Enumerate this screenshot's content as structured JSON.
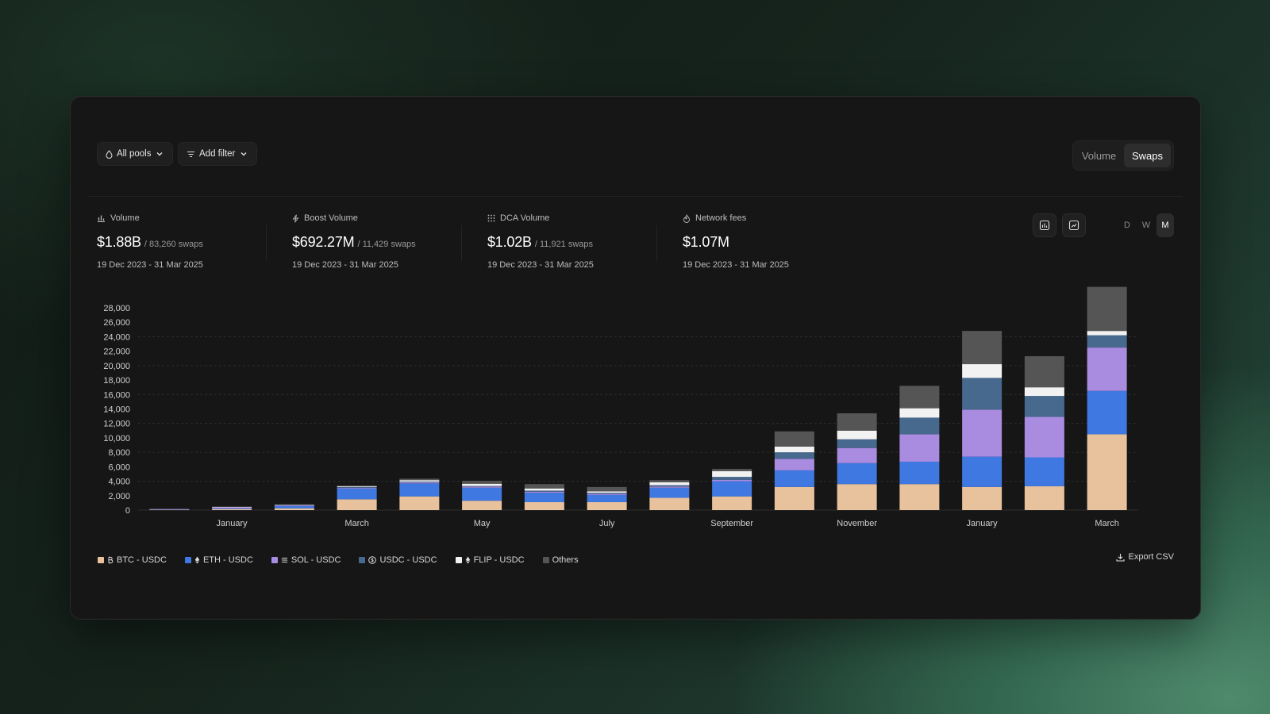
{
  "toolbar": {
    "pools_label": "All pools",
    "filter_label": "Add filter",
    "mode_volume": "Volume",
    "mode_swaps": "Swaps"
  },
  "stats": [
    {
      "label": "Volume",
      "value": "$1.88B",
      "sub": "/ 83,260 swaps",
      "dates": "19 Dec 2023 - 31 Mar 2025",
      "icon": "bar-chart-icon"
    },
    {
      "label": "Boost Volume",
      "value": "$692.27M",
      "sub": "/ 11,429 swaps",
      "dates": "19 Dec 2023 - 31 Mar 2025",
      "icon": "lightning-icon"
    },
    {
      "label": "DCA Volume",
      "value": "$1.02B",
      "sub": "/ 11,921 swaps",
      "dates": "19 Dec 2023 - 31 Mar 2025",
      "icon": "dots-grid-icon"
    },
    {
      "label": "Network fees",
      "value": "$1.07M",
      "sub": "",
      "dates": "19 Dec 2023 - 31 Mar 2025",
      "icon": "flame-icon"
    }
  ],
  "granularity": {
    "d": "D",
    "w": "W",
    "m": "M"
  },
  "legend": [
    {
      "label": "BTC - USDC",
      "color": "#e8c29c",
      "icon": "bitcoin-icon"
    },
    {
      "label": "ETH - USDC",
      "color": "#3f78e0",
      "icon": "ethereum-icon"
    },
    {
      "label": "SOL - USDC",
      "color": "#a98be0",
      "icon": "solana-icon"
    },
    {
      "label": "USDC - USDC",
      "color": "#47698e",
      "icon": "usdc-icon"
    },
    {
      "label": "FLIP - USDC",
      "color": "#f2f2f2",
      "icon": "flip-icon"
    },
    {
      "label": "Others",
      "color": "#555555",
      "icon": ""
    }
  ],
  "export_label": "Export CSV",
  "chart_data": {
    "type": "bar",
    "stacked": true,
    "categories": [
      "Dec 2023",
      "Jan 2024",
      "Feb 2024",
      "Mar 2024",
      "Apr 2024",
      "May 2024",
      "Jun 2024",
      "Jul 2024",
      "Aug 2024",
      "Sep 2024",
      "Oct 2024",
      "Nov 2024",
      "Dec 2024",
      "Jan 2025",
      "Feb 2025",
      "Mar 2025"
    ],
    "x_tick_labels": [
      "",
      "January",
      "",
      "March",
      "",
      "May",
      "",
      "July",
      "",
      "September",
      "",
      "November",
      "",
      "January",
      "",
      "March"
    ],
    "ylim": [
      0,
      28000
    ],
    "y_ticks": [
      0,
      2000,
      4000,
      6000,
      8000,
      10000,
      12000,
      14000,
      16000,
      18000,
      20000,
      22000,
      24000,
      26000,
      28000
    ],
    "series": [
      {
        "name": "BTC - USDC",
        "color": "#e8c29c",
        "values": [
          50,
          150,
          250,
          1500,
          1900,
          1300,
          1100,
          1100,
          1700,
          1900,
          3200,
          3600,
          3600,
          3200,
          3300,
          10500
        ]
      },
      {
        "name": "ETH - USDC",
        "color": "#3f78e0",
        "values": [
          50,
          100,
          300,
          1500,
          1800,
          1800,
          1300,
          1000,
          1400,
          2100,
          2300,
          2900,
          3100,
          4200,
          4000,
          6000
        ]
      },
      {
        "name": "SOL - USDC",
        "color": "#a98be0",
        "values": [
          50,
          150,
          100,
          100,
          150,
          150,
          150,
          150,
          150,
          200,
          1600,
          2100,
          3800,
          6500,
          5600,
          6000
        ]
      },
      {
        "name": "USDC - USDC",
        "color": "#47698e",
        "values": [
          0,
          0,
          50,
          100,
          100,
          100,
          150,
          150,
          200,
          400,
          900,
          1200,
          2300,
          4400,
          2900,
          1700
        ]
      },
      {
        "name": "FLIP - USDC",
        "color": "#f2f2f2",
        "values": [
          0,
          50,
          50,
          100,
          200,
          300,
          300,
          200,
          400,
          800,
          800,
          1200,
          1300,
          1900,
          1200,
          600
        ]
      },
      {
        "name": "Others",
        "color": "#555555",
        "values": [
          0,
          50,
          50,
          100,
          200,
          400,
          600,
          600,
          300,
          300,
          2100,
          2400,
          3100,
          4600,
          4300,
          6100
        ]
      }
    ],
    "grid": "dashed-horizontal"
  }
}
